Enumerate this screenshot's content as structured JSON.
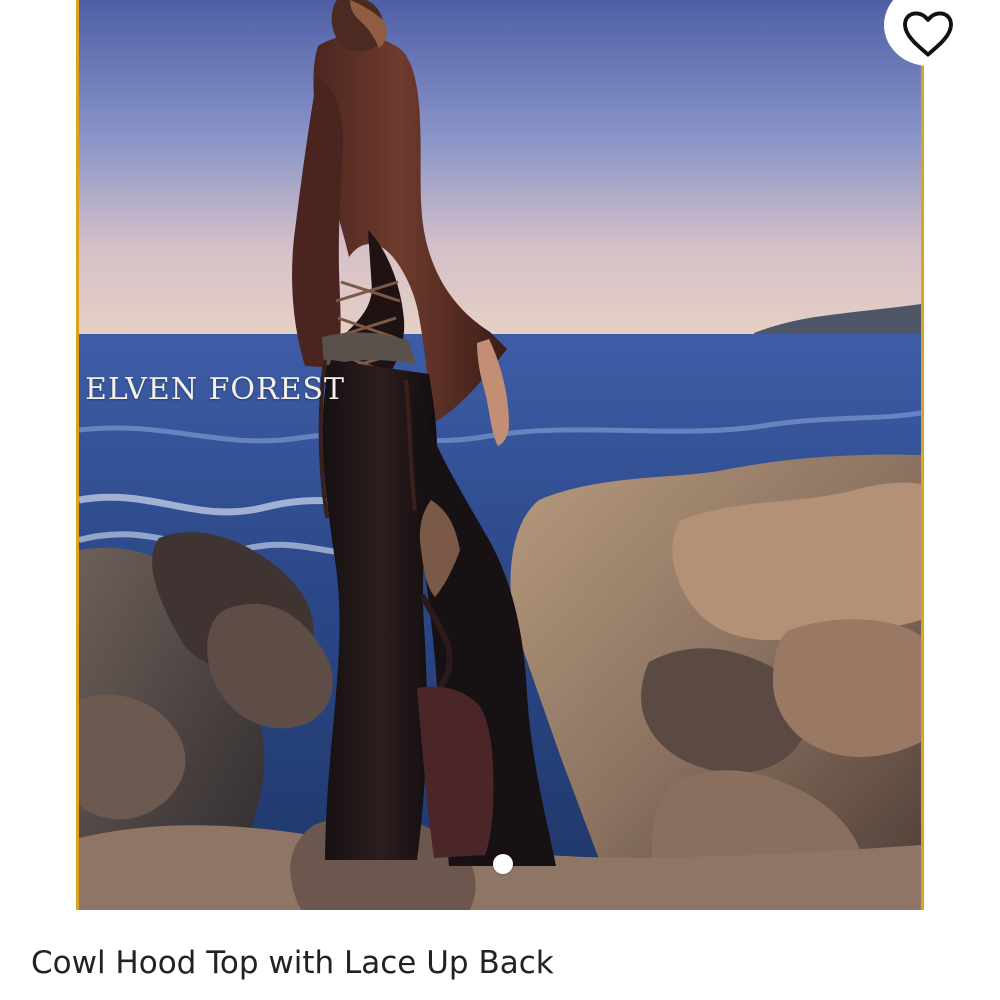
{
  "product": {
    "title": "Cowl Hood Top with Lace Up Back",
    "image_watermark": "ELVEN FOREST",
    "carousel": {
      "current_slide": 1
    }
  },
  "icons": {
    "favorite": "heart-outline-icon"
  },
  "colors": {
    "frame_border": "#d9a521",
    "title_text": "#222222"
  }
}
